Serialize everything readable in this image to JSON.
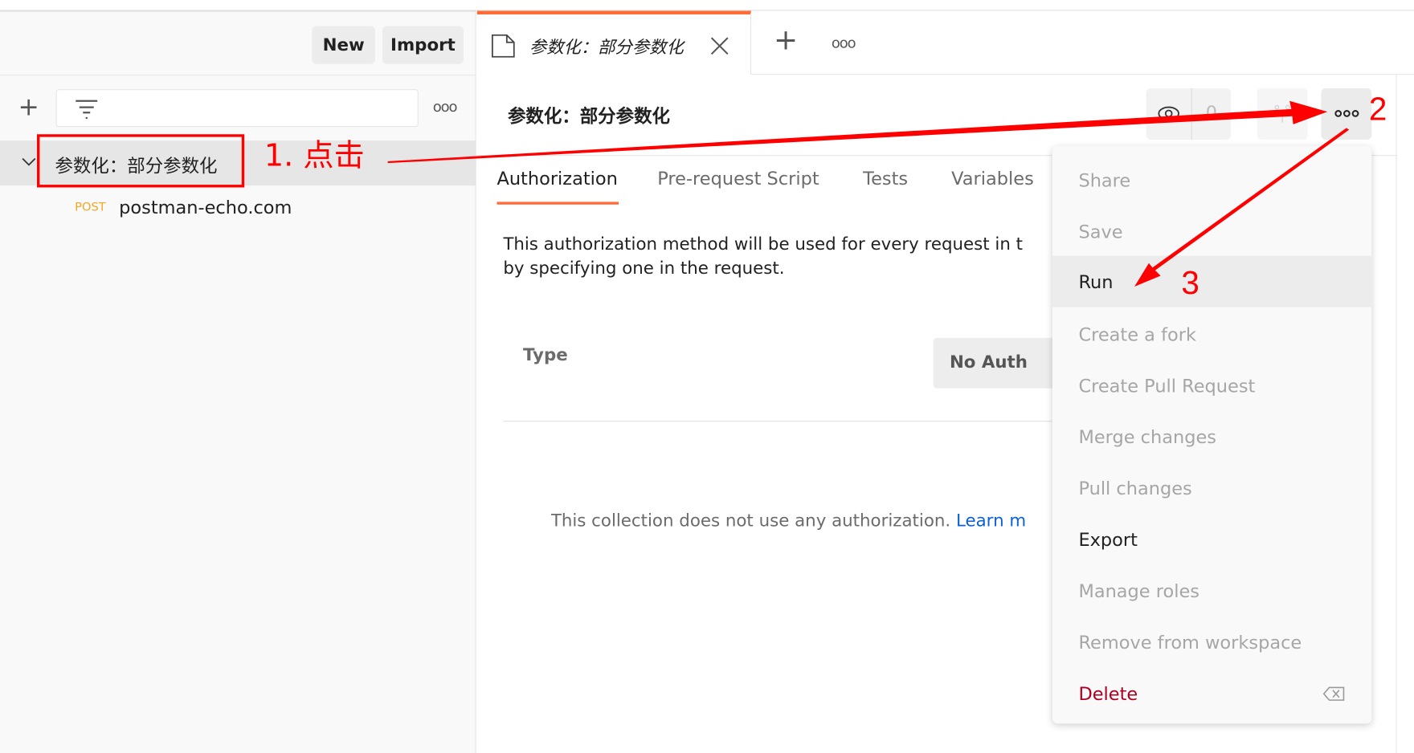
{
  "sidebar": {
    "new_label": "New",
    "import_label": "Import",
    "collection_name": "参数化：部分参数化",
    "request": {
      "method": "POST",
      "name": "postman-echo.com"
    }
  },
  "tabbar": {
    "tab_title": "参数化：部分参数化"
  },
  "main": {
    "title": "参数化：部分参数化",
    "watch_count": "0",
    "tabs": [
      {
        "label": "Authorization",
        "active": true
      },
      {
        "label": "Pre-request Script"
      },
      {
        "label": "Tests"
      },
      {
        "label": "Variables"
      }
    ],
    "auth_desc_line1": "This authorization method will be used for every request in t",
    "auth_desc_line2": "by specifying one in the request.",
    "type_label": "Type",
    "type_value": "No Auth",
    "no_auth_text": "This collection does not use any authorization.",
    "learn_more": "Learn m"
  },
  "menu": {
    "items": [
      {
        "label": "Share",
        "enabled": false
      },
      {
        "label": "Save",
        "enabled": false
      },
      {
        "label": "Run",
        "enabled": true,
        "highlighted": true
      },
      {
        "label": "Create a fork",
        "enabled": false
      },
      {
        "label": "Create Pull Request",
        "enabled": false
      },
      {
        "label": "Merge changes",
        "enabled": false
      },
      {
        "label": "Pull changes",
        "enabled": false
      },
      {
        "label": "Export",
        "enabled": true
      },
      {
        "label": "Manage roles",
        "enabled": false
      },
      {
        "label": "Remove from workspace",
        "enabled": false
      },
      {
        "label": "Delete",
        "enabled": true,
        "danger": true
      }
    ]
  },
  "annotations": {
    "step1": "1. 点击",
    "step2": "2",
    "step3": "3"
  },
  "colors": {
    "accent": "#ff6c37",
    "annotation": "#ff0000",
    "link": "#0b62d6",
    "danger": "#b00020",
    "method_post": "#f5a623"
  }
}
